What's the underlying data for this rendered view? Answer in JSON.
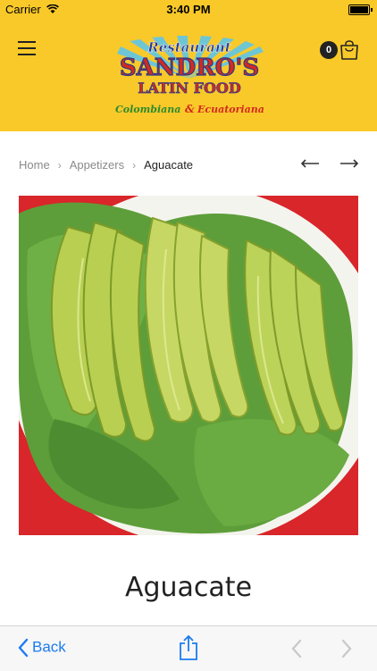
{
  "status_bar": {
    "carrier": "Carrier",
    "time": "3:40 PM"
  },
  "header": {
    "logo": {
      "line1": "Restaurant",
      "line2": "SANDRO'S",
      "line3": "LATIN FOOD",
      "line4a": "Colombiana",
      "line4b": "&",
      "line4c": "Ecuatoriana"
    },
    "cart_count": "0"
  },
  "breadcrumb": {
    "home": "Home",
    "category": "Appetizers",
    "current": "Aguacate"
  },
  "product": {
    "title": "Aguacate"
  },
  "toolbar": {
    "back_label": "Back"
  },
  "colors": {
    "header_bg": "#f9c929",
    "link_blue": "#1a7bf0",
    "photo_red": "#d8262a"
  }
}
